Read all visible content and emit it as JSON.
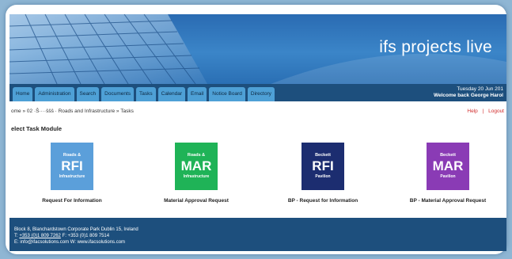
{
  "brand": "ifs projects live",
  "nav": {
    "tabs": [
      "Home",
      "Administration",
      "Search",
      "Documents",
      "Tasks",
      "Calendar",
      "Email",
      "Notice Board",
      "Directory"
    ],
    "date": "Tuesday 20 Jun 201",
    "welcome": "Welcome back George Harol"
  },
  "breadcrumb": "ome » 02 ·Ŝ····ŝŝŝ · Roads and Infrastructure » Tasks",
  "util": {
    "help": "Help",
    "sep": "|",
    "logout": "Logout"
  },
  "section_title": "elect Task Module",
  "modules": [
    {
      "top": "Roads &",
      "code": "RFI",
      "bottom": "Infrastructure",
      "label": "Request For Information",
      "color": "#5b9fda"
    },
    {
      "top": "Roads &",
      "code": "MAR",
      "bottom": "Infrastructure",
      "label": "Material Approval Request",
      "color": "#1fb357"
    },
    {
      "top": "Beckett",
      "code": "RFI",
      "bottom": "Pavilion",
      "label": "BP - Request for Information",
      "color": "#1c2d70"
    },
    {
      "top": "Beckett",
      "code": "MAR",
      "bottom": "Pavilion",
      "label": "BP - Material Approval Request",
      "color": "#8a3bb5"
    }
  ],
  "footer": {
    "line1": "Block 8, Blanchardstown Corporate Park Dublin 15, Ireland",
    "line2_prefix": "T:",
    "phone": "+353 (0)1 809 7262",
    "line2_suffix": "F: +353 (0)1 809 7514",
    "line3": "E: info@ifacsolutions.com W: www.ifacsolutions.com"
  },
  "colors": {
    "accent": "#1d4f7d",
    "tab": "#4ea0d6",
    "background": "#8fb6d4"
  }
}
